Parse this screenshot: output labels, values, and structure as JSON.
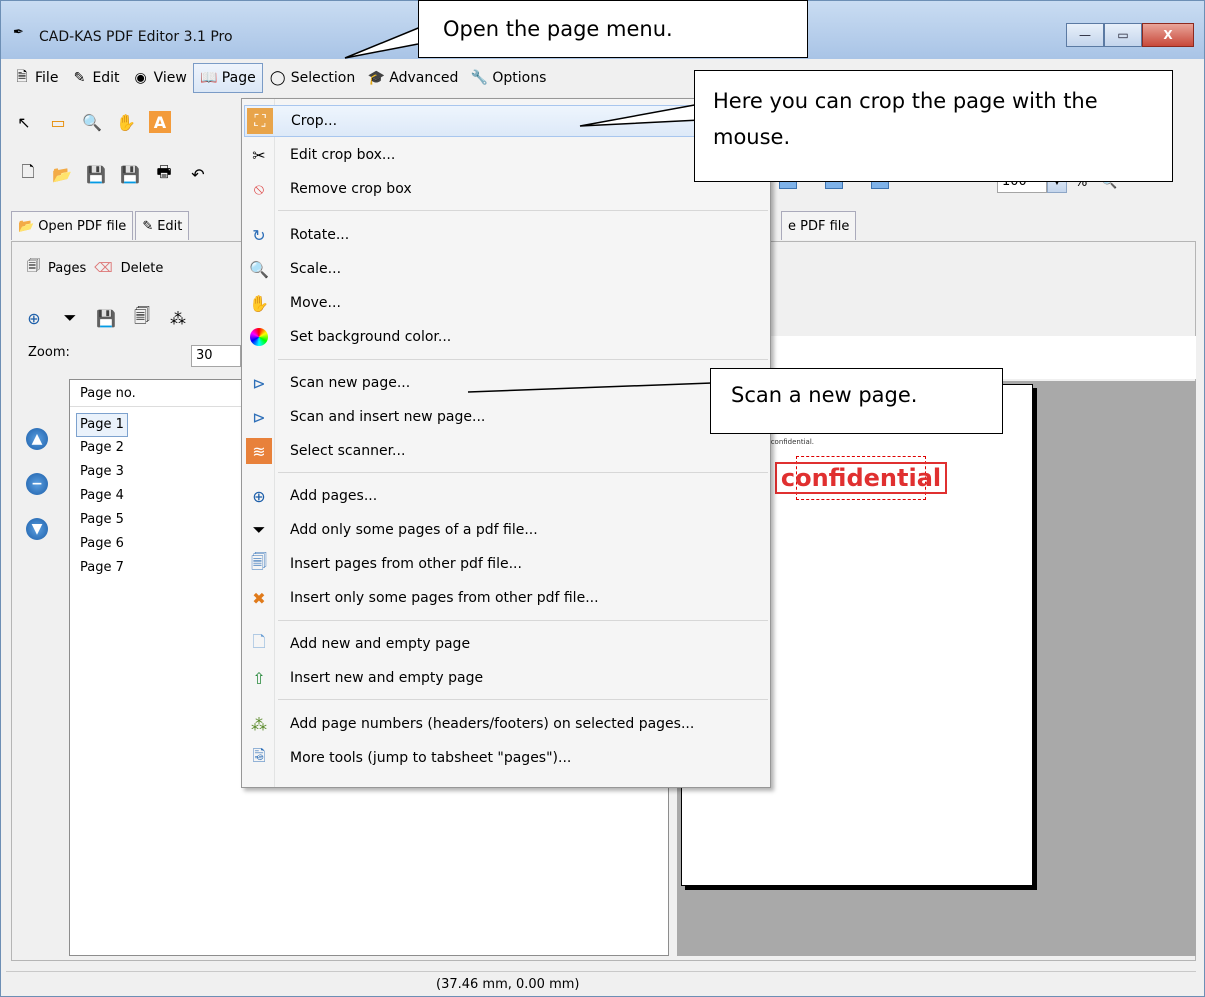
{
  "window": {
    "title": "CAD-KAS PDF Editor 3.1 Pro"
  },
  "window_buttons": {
    "minimize": "—",
    "maximize": "▭",
    "close": "X"
  },
  "menubar": [
    {
      "label": "File",
      "icon": "file-icon"
    },
    {
      "label": "Edit",
      "icon": "edit-icon"
    },
    {
      "label": "View",
      "icon": "view-icon"
    },
    {
      "label": "Page",
      "icon": "book-icon",
      "active": true
    },
    {
      "label": "Selection",
      "icon": "selection-icon"
    },
    {
      "label": "Advanced",
      "icon": "advanced-icon"
    },
    {
      "label": "Options",
      "icon": "wrench-icon"
    }
  ],
  "tabs": [
    {
      "label": "Open PDF file"
    },
    {
      "label": "Edit"
    },
    {
      "label": "e PDF file"
    }
  ],
  "pages_toolbar": {
    "pages_label": "Pages",
    "delete_label": "Delete"
  },
  "zoom": {
    "label": "Zoom:",
    "value": "30"
  },
  "zoom_right": {
    "value": "100",
    "unit": "%"
  },
  "page_list": {
    "header": "Page no.",
    "rows": [
      "Page 1",
      "Page 2",
      "Page 3",
      "Page 4",
      "Page 5",
      "Page 6",
      "Page 7"
    ],
    "selected": "Page 1"
  },
  "preview": {
    "text": "very confidential.",
    "stamp": "confidential"
  },
  "page_menu": [
    {
      "label": "Crop...",
      "icon": "crop-icon"
    },
    {
      "label": "Edit crop box...",
      "icon": "scissors-icon"
    },
    {
      "label": "Remove crop box",
      "icon": "no-entry-icon"
    },
    {
      "label": "Rotate...",
      "icon": "rotate-icon"
    },
    {
      "label": "Scale...",
      "icon": "magnifier-icon"
    },
    {
      "label": "Move...",
      "icon": "hand-icon"
    },
    {
      "label": "Set background color...",
      "icon": "color-wheel-icon"
    },
    {
      "label": "Scan new page...",
      "icon": "scanner-icon"
    },
    {
      "label": "Scan and insert new page...",
      "icon": "scanner-icon"
    },
    {
      "label": "Select scanner...",
      "icon": "scanner-select-icon"
    },
    {
      "label": "Add pages...",
      "icon": "plus-icon"
    },
    {
      "label": "Add only some pages of a pdf file...",
      "icon": "filter-icon"
    },
    {
      "label": "Insert pages from other pdf file...",
      "icon": "pages-icon"
    },
    {
      "label": "Insert only some pages from other pdf file...",
      "icon": "insert-some-icon"
    },
    {
      "label": "Add new and empty page",
      "icon": "blank-page-icon"
    },
    {
      "label": "Insert new and empty page",
      "icon": "insert-page-icon"
    },
    {
      "label": "Add page numbers (headers/footers) on selected pages...",
      "icon": "numbers-icon"
    },
    {
      "label": "More tools (jump to tabsheet \"pages\")...",
      "icon": "tools-icon"
    }
  ],
  "callouts": {
    "open_menu": "Open the page menu.",
    "crop_line1": "Here you can crop the page with the",
    "crop_line2": "mouse.",
    "scan": "Scan a new page."
  },
  "statusbar": {
    "coords": "(37.46 mm, 0.00 mm)"
  }
}
